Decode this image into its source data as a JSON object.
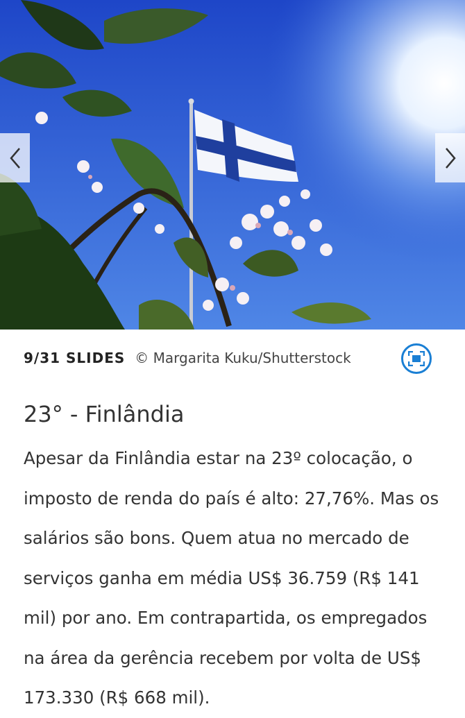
{
  "slide": {
    "counter": "9/31 SLIDES",
    "credit": "© Margarita Kuku/Shutterstock",
    "image_alt": "Finnish flag waving among blossoming branches under a blue sky"
  },
  "navigation": {
    "prev_icon": "chevron-left-icon",
    "next_icon": "chevron-right-icon",
    "fullscreen_icon": "fullscreen-icon"
  },
  "article": {
    "title": "23° - Finlândia",
    "body": "Apesar da Finlândia estar na 23º colocação, o imposto de renda do país é alto: 27,76%. Mas os salários são bons. Quem atua no mercado de serviços ganha em média US$ 36.759 (R$ 141 mil) por ano. Em contrapartida, os empregados na área da gerência recebem por volta de US$ 173.330 (R$ 668 mil)."
  },
  "colors": {
    "accent": "#1a7fd4",
    "text": "#333333",
    "sky": "#2f5fd6",
    "flag_blue": "#1f3f9e"
  }
}
